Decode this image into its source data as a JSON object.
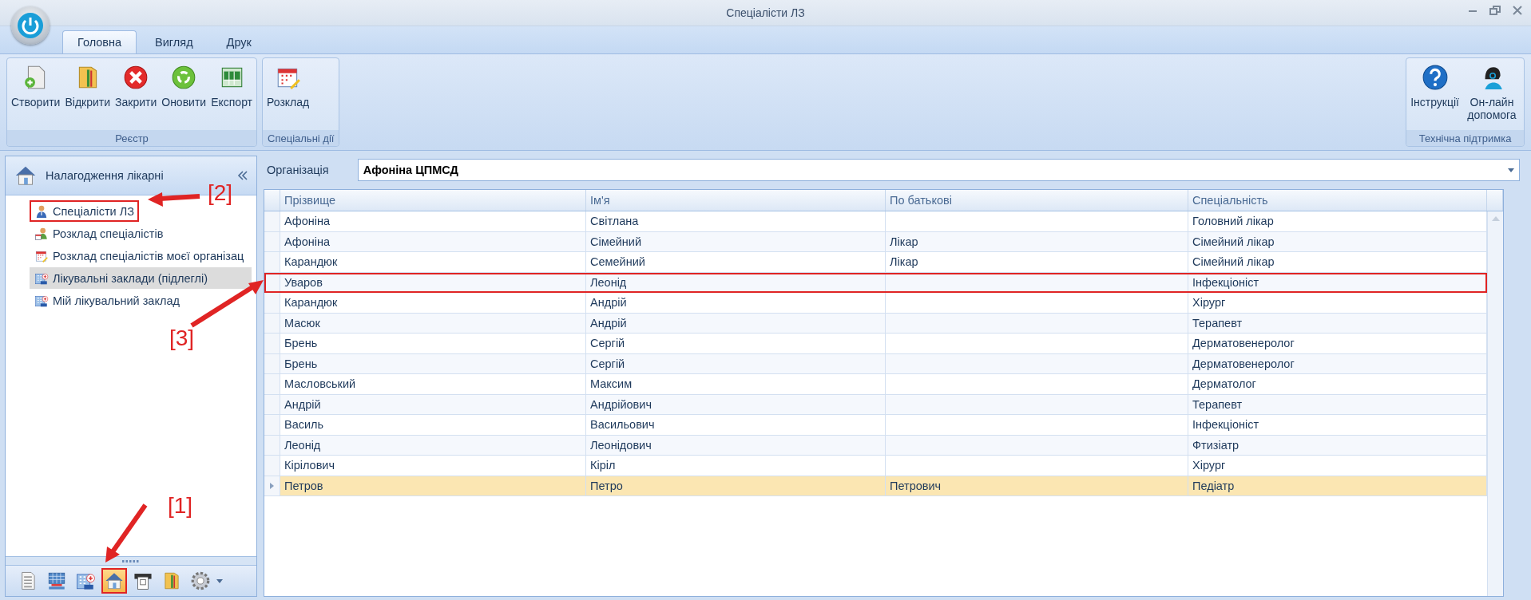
{
  "window": {
    "title": "Спеціалісти ЛЗ"
  },
  "ribbon": {
    "tabs": [
      {
        "label": "Головна",
        "selected": true
      },
      {
        "label": "Вигляд",
        "selected": false
      },
      {
        "label": "Друк",
        "selected": false
      }
    ],
    "groups": [
      {
        "label": "Реєстр",
        "buttons": [
          {
            "label": "Створити",
            "kind": "new"
          },
          {
            "label": "Відкрити",
            "kind": "folder"
          },
          {
            "label": "Закрити",
            "kind": "close"
          },
          {
            "label": "Оновити",
            "kind": "refresh"
          },
          {
            "label": "Експорт",
            "kind": "export"
          }
        ]
      },
      {
        "label": "Спеціальні дії",
        "buttons": [
          {
            "label": "Розклад",
            "kind": "calendar"
          }
        ]
      }
    ],
    "right_group": {
      "label": "Технічна підтримка",
      "buttons": [
        {
          "label": "Інструкції",
          "kind": "help"
        },
        {
          "label": "Он-лайн допомога",
          "kind": "support"
        }
      ]
    }
  },
  "sidebar": {
    "title": "Налагодження лікарні",
    "items": [
      {
        "label": "Спеціалісти ЛЗ",
        "kind": "doctor",
        "selected": false,
        "outlined": true
      },
      {
        "label": "Розклад спеціалістів",
        "kind": "doctor-calendar",
        "selected": false,
        "outlined": false
      },
      {
        "label": "Розклад спеціалістів моєї організац",
        "kind": "calendar",
        "selected": false,
        "outlined": false
      },
      {
        "label": "Лікувальні заклади (підлеглі)",
        "kind": "hospital",
        "selected": true,
        "outlined": false
      },
      {
        "label": "Мій лікувальний заклад",
        "kind": "hospital",
        "selected": false,
        "outlined": false
      }
    ],
    "toolbar": [
      {
        "kind": "document",
        "selected": false,
        "outlined": false
      },
      {
        "kind": "network",
        "selected": false,
        "outlined": false
      },
      {
        "kind": "hospital",
        "selected": false,
        "outlined": false
      },
      {
        "kind": "house",
        "selected": true,
        "outlined": true
      },
      {
        "kind": "printer",
        "selected": false,
        "outlined": false
      },
      {
        "kind": "folder",
        "selected": false,
        "outlined": false
      },
      {
        "kind": "gear",
        "selected": false,
        "outlined": false
      }
    ]
  },
  "organization": {
    "label": "Організація",
    "value": "Афоніна ЦПМСД"
  },
  "table": {
    "columns": [
      "Прізвище",
      "Ім'я",
      "По батькові",
      "Спеціальність"
    ],
    "rows": [
      {
        "cells": [
          "Афоніна",
          "Світлана",
          "",
          "Головний лікар"
        ],
        "selected": false,
        "outlined": false
      },
      {
        "cells": [
          "Афоніна",
          "Сімейний",
          "Лікар",
          "Сімейний лікар"
        ],
        "selected": false,
        "outlined": false
      },
      {
        "cells": [
          "Карандюк",
          "Семейний",
          "Лікар",
          "Сімейний лікар"
        ],
        "selected": false,
        "outlined": false
      },
      {
        "cells": [
          "Уваров",
          "Леонід",
          "",
          "Інфекціоніст"
        ],
        "selected": false,
        "outlined": true
      },
      {
        "cells": [
          "Карандюк",
          "Андрій",
          "",
          "Хірург"
        ],
        "selected": false,
        "outlined": false
      },
      {
        "cells": [
          "Масюк",
          "Андрій",
          "",
          "Терапевт"
        ],
        "selected": false,
        "outlined": false
      },
      {
        "cells": [
          "Брень",
          "Сергій",
          "",
          "Дерматовенеролог"
        ],
        "selected": false,
        "outlined": false
      },
      {
        "cells": [
          "Брень",
          "Сергій",
          "",
          "Дерматовенеролог"
        ],
        "selected": false,
        "outlined": false
      },
      {
        "cells": [
          "Масловський",
          "Максим",
          "",
          "Дерматолог"
        ],
        "selected": false,
        "outlined": false
      },
      {
        "cells": [
          "Андрій",
          "Андрійович",
          "",
          "Терапевт"
        ],
        "selected": false,
        "outlined": false
      },
      {
        "cells": [
          "Василь",
          "Васильович",
          "",
          "Інфекціоніст"
        ],
        "selected": false,
        "outlined": false
      },
      {
        "cells": [
          "Леонід",
          "Леонідович",
          "",
          "Фтизіатр"
        ],
        "selected": false,
        "outlined": false
      },
      {
        "cells": [
          "Кірілович",
          "Кіріл",
          "",
          "Хірург"
        ],
        "selected": false,
        "outlined": false
      },
      {
        "cells": [
          "Петров",
          "Петро",
          "Петрович",
          "Педіатр"
        ],
        "selected": true,
        "outlined": false
      }
    ]
  },
  "annotations": [
    {
      "label": "[1]"
    },
    {
      "label": "[2]"
    },
    {
      "label": "[3]"
    }
  ]
}
